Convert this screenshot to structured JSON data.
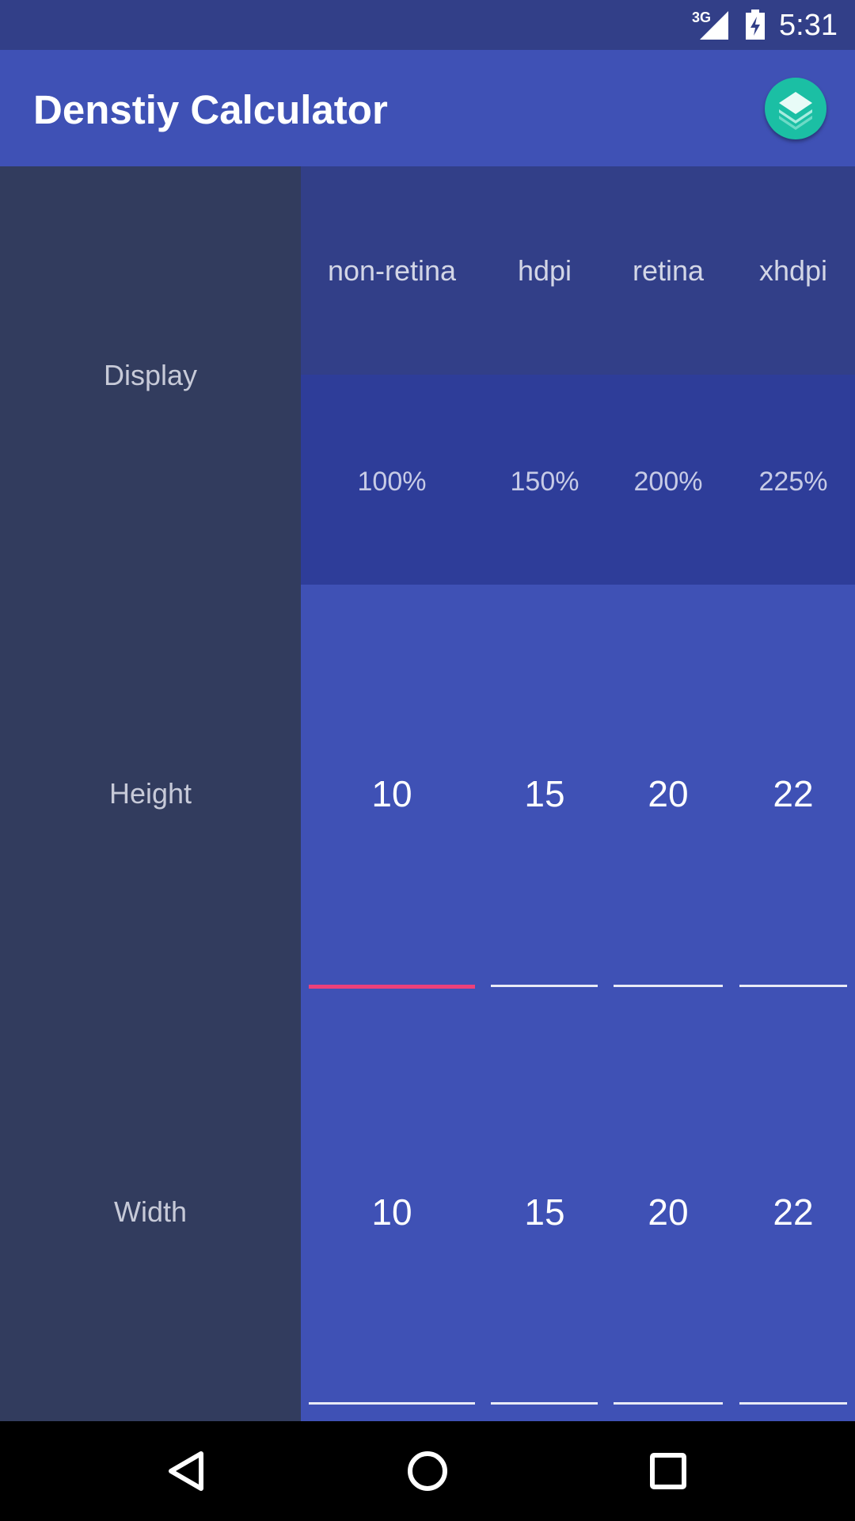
{
  "status_bar": {
    "network": "3G",
    "time": "5:31"
  },
  "app_bar": {
    "title": "Denstiy Calculator",
    "logo_icon": "layers-logo-icon",
    "colors": {
      "primary": "#3F51B5",
      "primary_dark": "#323F88",
      "accent": "#EC407A"
    }
  },
  "rows": {
    "display_label": "Display",
    "height_label": "Height",
    "width_label": "Width"
  },
  "displays": [
    {
      "name": "non-retina",
      "scale": "100%"
    },
    {
      "name": "hdpi",
      "scale": "150%"
    },
    {
      "name": "retina",
      "scale": "200%"
    },
    {
      "name": "xhdpi",
      "scale": "225%"
    }
  ],
  "height_values": [
    "10",
    "15",
    "20",
    "22"
  ],
  "width_values": [
    "10",
    "15",
    "20",
    "22"
  ],
  "nav_bar": {
    "back_icon": "back-triangle-icon",
    "home_icon": "home-circle-icon",
    "recents_icon": "recents-square-icon"
  }
}
